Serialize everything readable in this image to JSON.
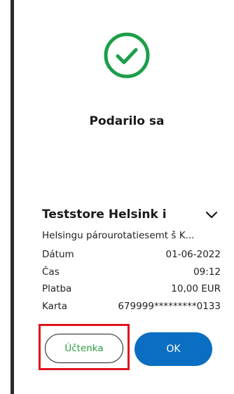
{
  "status": {
    "title": "Podarilo sa",
    "icon": "check-circle-icon",
    "color": "#1e9e4a"
  },
  "store": {
    "name": "Teststore Helsink i",
    "address": "Helsingu párourotatiesemt š  K..."
  },
  "details": [
    {
      "label": "Dátum",
      "value": "01-06-2022"
    },
    {
      "label": "Čas",
      "value": "09:12"
    },
    {
      "label": "Platba",
      "value": "10,00 EUR"
    },
    {
      "label": "Karta",
      "value": "679999*********0133"
    }
  ],
  "buttons": {
    "receipt_label": "Účtenka",
    "ok_label": "OK"
  },
  "colors": {
    "accent": "#0a6fc2",
    "success": "#1e9e4a",
    "receipt_text": "#2f9e44",
    "highlight": "#e0151f"
  }
}
